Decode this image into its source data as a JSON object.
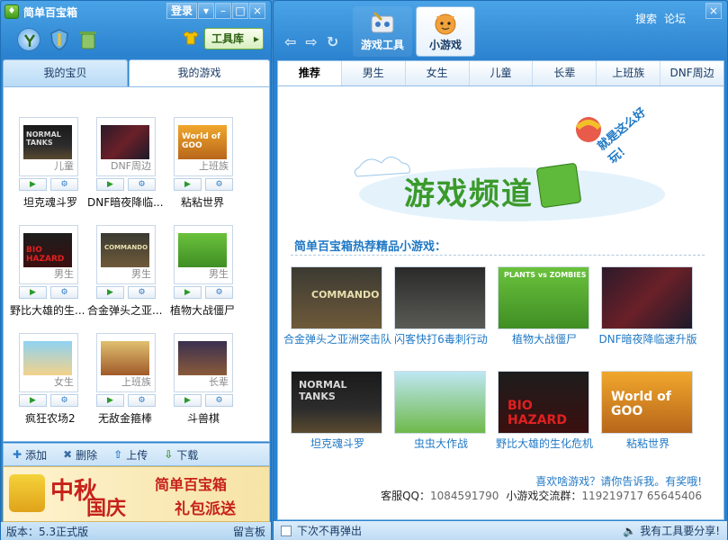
{
  "left": {
    "title": "简单百宝箱",
    "login_label": "登录",
    "toolbox_label": "工具库",
    "tabs": [
      {
        "label": "我的宝贝",
        "active": false
      },
      {
        "label": "我的游戏",
        "active": true
      }
    ],
    "games": [
      {
        "name": "坦克魂斗罗",
        "category": "儿童",
        "icon": "normal-tanks"
      },
      {
        "name": "DNF暗夜降临...",
        "category": "DNF周边",
        "icon": "dnf"
      },
      {
        "name": "粘粘世界",
        "category": "上班族",
        "icon": "world-of-goo"
      },
      {
        "name": "野比大雄的生...",
        "category": "男生",
        "icon": "bio-hazard"
      },
      {
        "name": "合金弹头之亚...",
        "category": "男生",
        "icon": "commando"
      },
      {
        "name": "植物大战僵尸",
        "category": "男生",
        "icon": "pvz"
      },
      {
        "name": "疯狂农场2",
        "category": "女生",
        "icon": "farm"
      },
      {
        "name": "无敌金箍棒",
        "category": "上班族",
        "icon": "golden-staff"
      },
      {
        "name": "斗兽棋",
        "category": "长辈",
        "icon": "beast-chess"
      }
    ],
    "actions": {
      "add": "添加",
      "delete": "删除",
      "upload": "上传",
      "download": "下载"
    },
    "banner": {
      "text1": "中秋",
      "text2": "国庆",
      "text3": "简单百宝箱",
      "text4": "礼包派送"
    },
    "version": "版本：5.3正式版",
    "guestbook": "留言板"
  },
  "right": {
    "top_tabs": [
      {
        "label": "游戏工具",
        "active": false
      },
      {
        "label": "小游戏",
        "active": true
      }
    ],
    "links": {
      "search": "搜索",
      "forum": "论坛"
    },
    "categories": [
      "推荐",
      "男生",
      "女生",
      "儿童",
      "长辈",
      "上班族",
      "DNF周边"
    ],
    "hero": {
      "title": "游戏频道",
      "slogan": "就是这么好玩！"
    },
    "rec_title": "简单百宝箱热荐精品小游戏：",
    "rec_games": [
      {
        "name": "合金弹头之亚洲突击队",
        "icon": "commando"
      },
      {
        "name": "闪客快打6毒刺行动",
        "icon": "ninja"
      },
      {
        "name": "植物大战僵尸",
        "icon": "pvz"
      },
      {
        "name": "DNF暗夜降临速升版",
        "icon": "dnf"
      },
      {
        "name": "坦克魂斗罗",
        "icon": "normal-tanks"
      },
      {
        "name": "虫虫大作战",
        "icon": "bug-war"
      },
      {
        "name": "野比大雄的生化危机",
        "icon": "bio-hazard"
      },
      {
        "name": "粘粘世界",
        "icon": "world-of-goo"
      }
    ],
    "feedback": "喜欢啥游戏？请你告诉我。有奖哦!",
    "qq_label": "客服QQ：",
    "qq_number": "1084591790",
    "group_label": "小游戏交流群：",
    "group_numbers": "119219717 65645406",
    "dont_show": "下次不再弹出",
    "share": "我有工具要分享!"
  },
  "thumb_text": {
    "normal-tanks": "NORMAL TANKS",
    "world-of-goo": "World of GOO",
    "bio-hazard": "BIO HAZARD",
    "commando": "COMMANDO",
    "pvz": "PLANTS vs ZOMBIES"
  }
}
